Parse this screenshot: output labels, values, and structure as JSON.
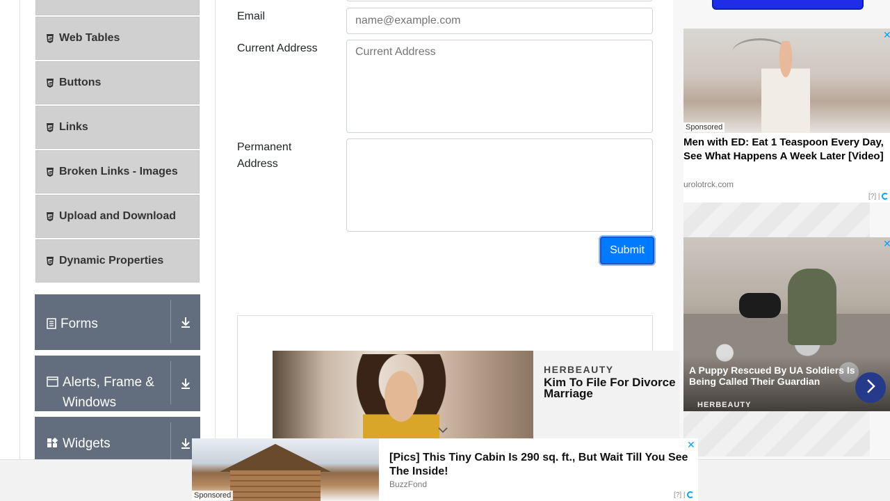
{
  "sidebar": {
    "elements_items": [
      {
        "label": "Web Tables"
      },
      {
        "label": "Buttons"
      },
      {
        "label": "Links"
      },
      {
        "label": "Broken Links - Images"
      },
      {
        "label": "Upload and Download"
      },
      {
        "label": "Dynamic Properties"
      }
    ],
    "groups": [
      {
        "label": "Forms",
        "icon": "document-icon"
      },
      {
        "label": "Alerts, Frame & Windows",
        "icon": "window-icon"
      },
      {
        "label": "Widgets",
        "icon": "widgets-icon"
      }
    ]
  },
  "form": {
    "email_label": "Email",
    "email_placeholder": "name@example.com",
    "current_address_label": "Current Address",
    "current_address_placeholder": "Current Address",
    "permanent_address_label": "Permanent Address",
    "submit_label": "Submit"
  },
  "ads": {
    "right_top": {
      "sponsored": "Sponsored",
      "title": "Men with ED: Eat 1 Teaspoon Every Day, See What Happens A Week Later [Video]",
      "source": "urolotrck.com",
      "adchoice": "[?]",
      "close": "✕"
    },
    "right_bottom": {
      "title": "A Puppy Rescued By UA Soldiers Is Being Called Their Guardian",
      "source": "HERBEAUTY",
      "close": "✕"
    },
    "middle": {
      "brand": "HERBEAUTY",
      "title": "Kim To File For Divorce Marriage"
    },
    "bottom": {
      "sponsored": "Sponsored",
      "title": "[Pics] This Tiny Cabin Is 290 sq. ft., But Wait Till You See The Inside!",
      "source": "BuzzFond",
      "adchoice": "[?]",
      "close": "✕"
    }
  },
  "colors": {
    "submit": "#007bff",
    "group_bg": "#626e7d",
    "menu_bg": "#d0d0d0"
  }
}
